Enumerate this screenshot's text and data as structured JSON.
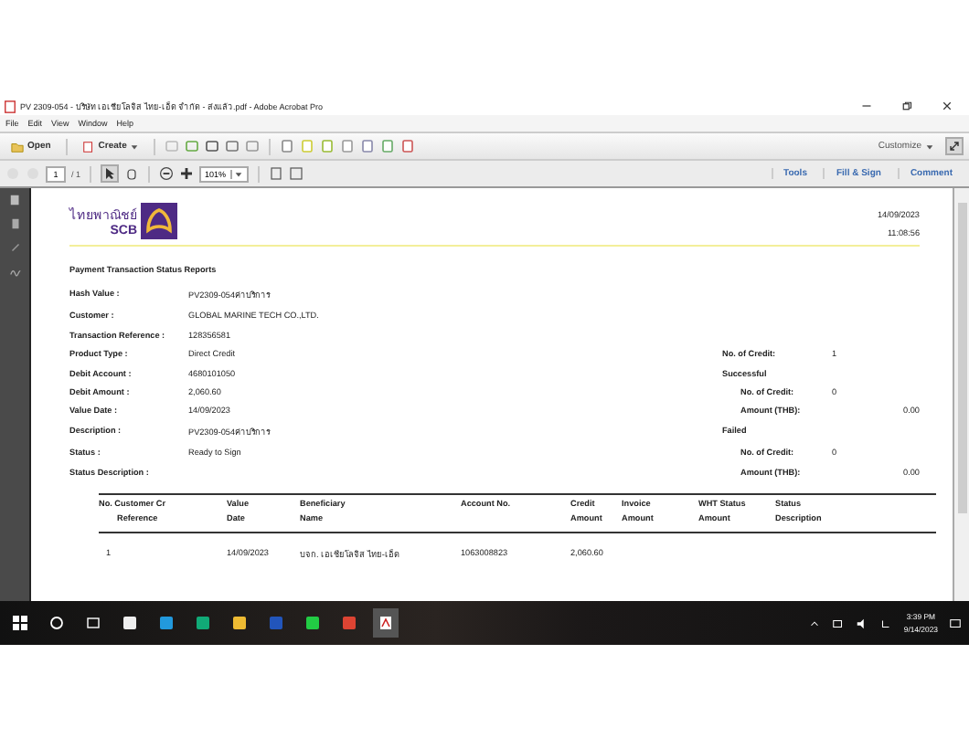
{
  "window": {
    "title": "PV 2309-054 - บริษัท เอเชียโลจิส ไทย-เอ็ด จำกัด - ส่งแล้ว.pdf - Adobe Acrobat Pro"
  },
  "menu": [
    "File",
    "Edit",
    "View",
    "Window",
    "Help"
  ],
  "toolbar": {
    "open": "Open",
    "create": "Create",
    "customize": "Customize"
  },
  "nav": {
    "page": "1",
    "page_count": "/ 1",
    "zoom": "101%",
    "panes": [
      {
        "label": "Tools",
        "selected": false
      },
      {
        "label": "Fill & Sign",
        "selected": false
      },
      {
        "label": "Comment",
        "selected": false
      }
    ]
  },
  "document": {
    "logo_text": "ไทยพาณิชย์",
    "logo_brand": "SCB",
    "date": "14/09/2023",
    "time": "11:08:56",
    "heading": "Payment Transaction Status Reports",
    "fields": [
      {
        "label": "Hash Value :",
        "value": "PV2309-054ค่าบริการ"
      },
      {
        "label": "Customer :",
        "value": "GLOBAL MARINE TECH CO.,LTD."
      },
      {
        "label": "Transaction Reference :",
        "value": "128356581"
      },
      {
        "label": "Product Type :",
        "value": "Direct Credit"
      },
      {
        "label": "Debit Account :",
        "value": "4680101050"
      },
      {
        "label": "Debit Amount :",
        "value": "2,060.60"
      },
      {
        "label": "Value Date :",
        "value": "14/09/2023"
      },
      {
        "label": "Description :",
        "value": "PV2309-054ค่าบริการ"
      },
      {
        "label": "Status :",
        "value": "Ready to Sign"
      },
      {
        "label": "Status Description :"
      }
    ],
    "summary": [
      {
        "kind": "count",
        "label": "No. of Credit:",
        "value": "1"
      },
      {
        "kind": "group",
        "label": "Successful",
        "items": [
          {
            "kind": "count",
            "label": "No. of Credit:",
            "value": "0"
          },
          {
            "kind": "amount",
            "label": "Amount (THB):",
            "value": "0.00"
          }
        ]
      },
      {
        "kind": "group",
        "label": "Failed",
        "items": [
          {
            "kind": "count",
            "label": "No. of Credit:",
            "value": "0"
          },
          {
            "kind": "amount",
            "label": "Amount (THB):",
            "value": "0.00"
          }
        ]
      }
    ],
    "table": {
      "columns": [
        {
          "label": "No. Customer Cr",
          "sublabel": "Reference"
        },
        {
          "label": "Value",
          "sublabel": "Date"
        },
        {
          "label": "Beneficiary",
          "sublabel": "Name"
        },
        {
          "label": "Account No."
        },
        {
          "label": "Credit",
          "sublabel": "Amount"
        },
        {
          "label": "Invoice",
          "sublabel": "Amount"
        },
        {
          "label": "WHT Status",
          "sublabel": "Amount"
        },
        {
          "label": "Status",
          "sublabel": "Description"
        }
      ],
      "rows": [
        [
          "1",
          "14/09/2023",
          "บจก. เอเชียโลจิส ไทย-เอ็ด",
          "1063008823",
          "2,060.60",
          "",
          "",
          ""
        ]
      ]
    }
  },
  "taskbar": {
    "time": "3:39 PM",
    "date": "9/14/2023"
  }
}
